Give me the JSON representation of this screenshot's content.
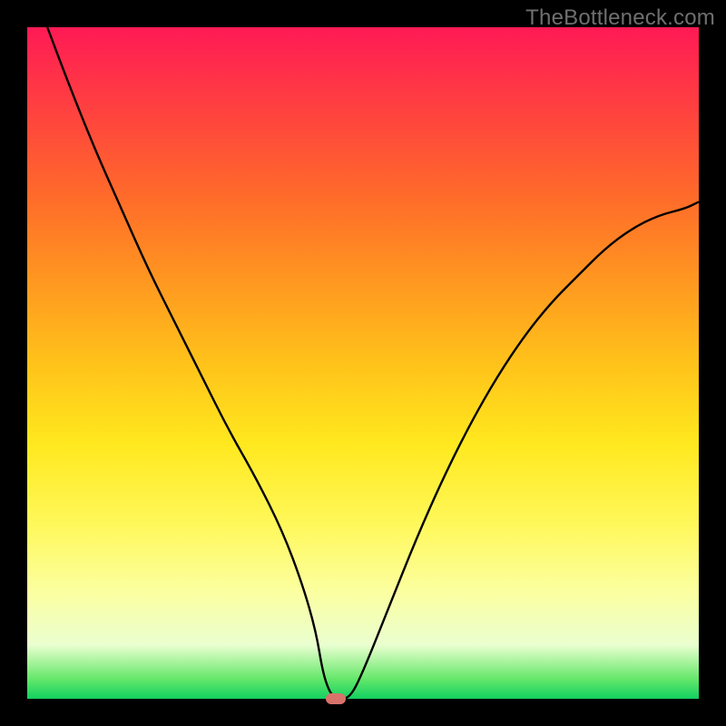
{
  "watermark": "TheBottleneck.com",
  "colors": {
    "frame": "#000000",
    "curve": "#000000",
    "marker": "#d8736b",
    "watermark_text": "#6f6f6f"
  },
  "chart_data": {
    "type": "line",
    "title": "",
    "xlabel": "",
    "ylabel": "",
    "xlim": [
      0,
      100
    ],
    "ylim": [
      0,
      100
    ],
    "grid": false,
    "series": [
      {
        "name": "bottleneck-curve",
        "x": [
          3,
          6,
          10,
          14,
          18,
          22,
          26,
          30,
          34,
          38,
          41,
          43,
          44,
          45,
          46,
          48,
          50,
          54,
          58,
          62,
          66,
          70,
          74,
          78,
          82,
          86,
          90,
          94,
          98,
          100
        ],
        "values": [
          100,
          92,
          82,
          73,
          64,
          56,
          48,
          40,
          33,
          25,
          17,
          10,
          4,
          1,
          0,
          0,
          4,
          14,
          24,
          33,
          41,
          48,
          54,
          59,
          63,
          67,
          70,
          72,
          73,
          74
        ]
      }
    ],
    "marker": {
      "x": 46,
      "y": 0
    },
    "gradient_stops": [
      {
        "pos": 0,
        "color": "#ff1a55"
      },
      {
        "pos": 12,
        "color": "#ff4040"
      },
      {
        "pos": 25,
        "color": "#ff6a2a"
      },
      {
        "pos": 38,
        "color": "#ff9820"
      },
      {
        "pos": 50,
        "color": "#ffc21a"
      },
      {
        "pos": 62,
        "color": "#ffe81e"
      },
      {
        "pos": 74,
        "color": "#fff85a"
      },
      {
        "pos": 84,
        "color": "#fcffa0"
      },
      {
        "pos": 92,
        "color": "#eaffd0"
      },
      {
        "pos": 97,
        "color": "#66e86b"
      },
      {
        "pos": 100,
        "color": "#12d060"
      }
    ]
  }
}
